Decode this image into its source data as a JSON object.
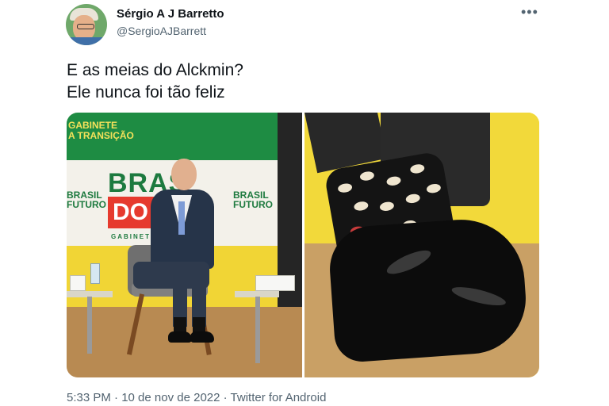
{
  "author": {
    "name": "Sérgio A J Barretto",
    "handle": "@SergioAJBarrett",
    "avatar_icon": "profile-photo"
  },
  "more_icon": "more-options-icon",
  "tweet": {
    "lines": [
      "E as meias do Alckmin?",
      "Ele nunca foi tão feliz"
    ]
  },
  "media": {
    "photo1": {
      "banner_gabinete": "GABINETE",
      "banner_transicao": "A TRANSIÇÃO",
      "brasil": "BRAS",
      "do_futuro": "DO FU",
      "gabinete_small": "GABINETE",
      "brasil_left_1": "BRASIL",
      "brasil_left_2": "FUTURO",
      "brasil_right_1": "BRASIL",
      "brasil_right_2": "FUTURO"
    }
  },
  "footer": {
    "meta": "5:33 PM · 10 de nov de 2022 · Twitter for Android"
  },
  "colors": {
    "text_primary": "#0f1419",
    "text_secondary": "#536471",
    "banner_green": "#1e8c43",
    "banner_yellow": "#f1d535",
    "banner_red": "#e63a2e"
  }
}
